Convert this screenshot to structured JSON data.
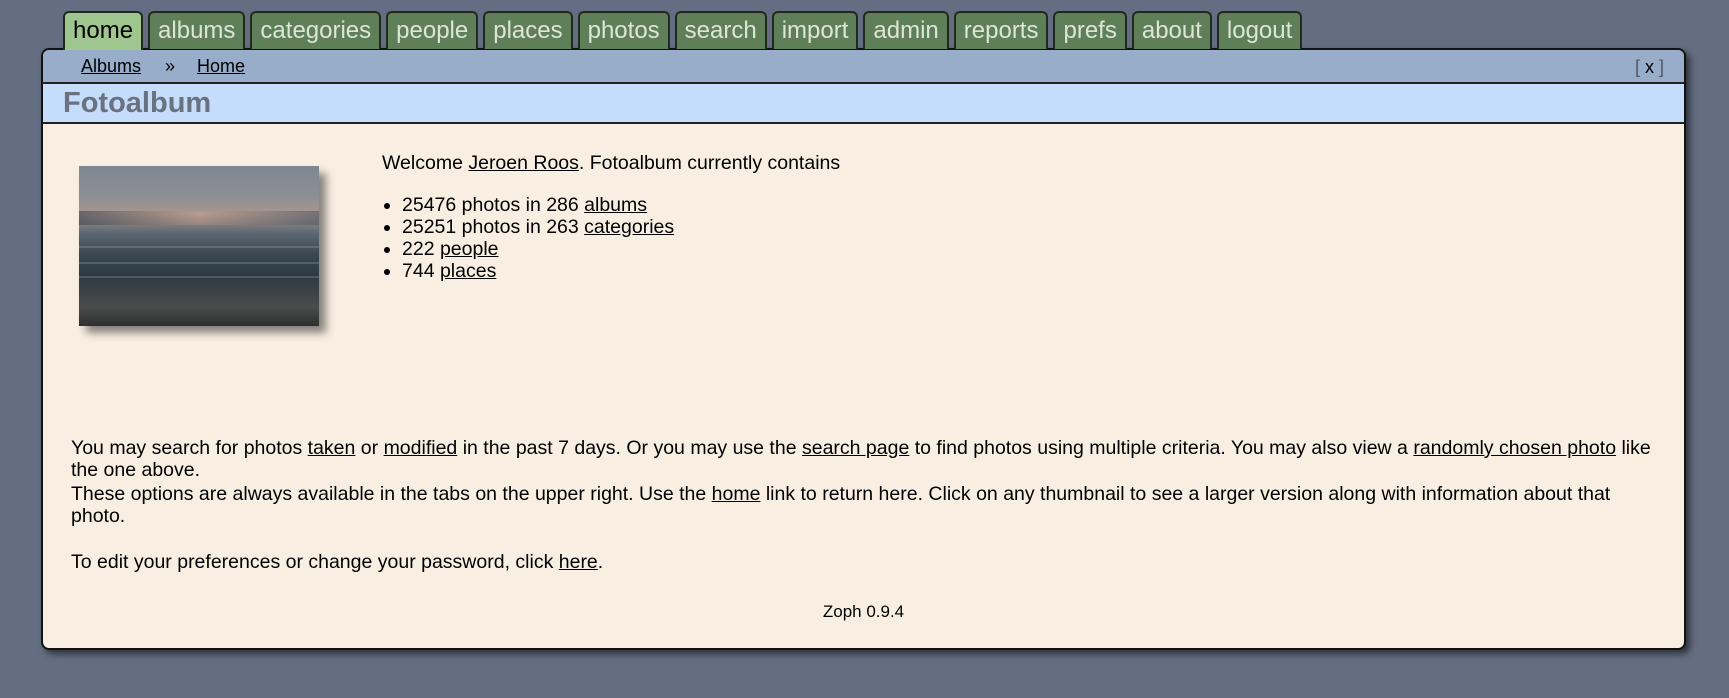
{
  "nav": {
    "tabs": [
      {
        "label": "home",
        "active": true
      },
      {
        "label": "albums"
      },
      {
        "label": "categories"
      },
      {
        "label": "people"
      },
      {
        "label": "places"
      },
      {
        "label": "photos"
      },
      {
        "label": "search"
      },
      {
        "label": "import"
      },
      {
        "label": "admin"
      },
      {
        "label": "reports"
      },
      {
        "label": "prefs"
      },
      {
        "label": "about"
      },
      {
        "label": "logout"
      }
    ]
  },
  "breadcrumb": {
    "items": [
      "Albums",
      "Home"
    ],
    "separator": "»",
    "close_label": "x"
  },
  "page": {
    "title": "Fotoalbum"
  },
  "welcome": {
    "prefix": "Welcome ",
    "user_name": "Jeroen Roos",
    "suffix": ". Fotoalbum currently contains"
  },
  "stats": [
    {
      "text": "25476 photos in 286 ",
      "link": "albums"
    },
    {
      "text": "25251 photos in 263 ",
      "link": "categories"
    },
    {
      "text": "222 ",
      "link": "people"
    },
    {
      "text": "744 ",
      "link": "places"
    }
  ],
  "search_para": {
    "t1": "You may search for photos ",
    "l1": "taken",
    "t2": " or ",
    "l2": "modified",
    "t3": " in the past 7 days. Or you may use the ",
    "l3": "search page",
    "t4": " to find photos using multiple criteria. You may also view a ",
    "l4": "randomly chosen photo",
    "t5": " like the one above."
  },
  "options_para": {
    "t1": "These options are always available in the tabs on the upper right. Use the ",
    "l1": "home",
    "t2": " link to return here. Click on any thumbnail to see a larger version along with information about that photo."
  },
  "prefs_para": {
    "t1": "To edit your preferences or change your password, click ",
    "l1": "here",
    "t2": "."
  },
  "footer": {
    "version": "Zoph 0.9.4"
  },
  "colors": {
    "background": "#646e82",
    "tab": "#5f7f58",
    "tab_active": "#9ec68e",
    "breadcrumb_bar": "#97adc9",
    "title_bar": "#c6dcfb",
    "content_bg": "#f9eee2"
  }
}
